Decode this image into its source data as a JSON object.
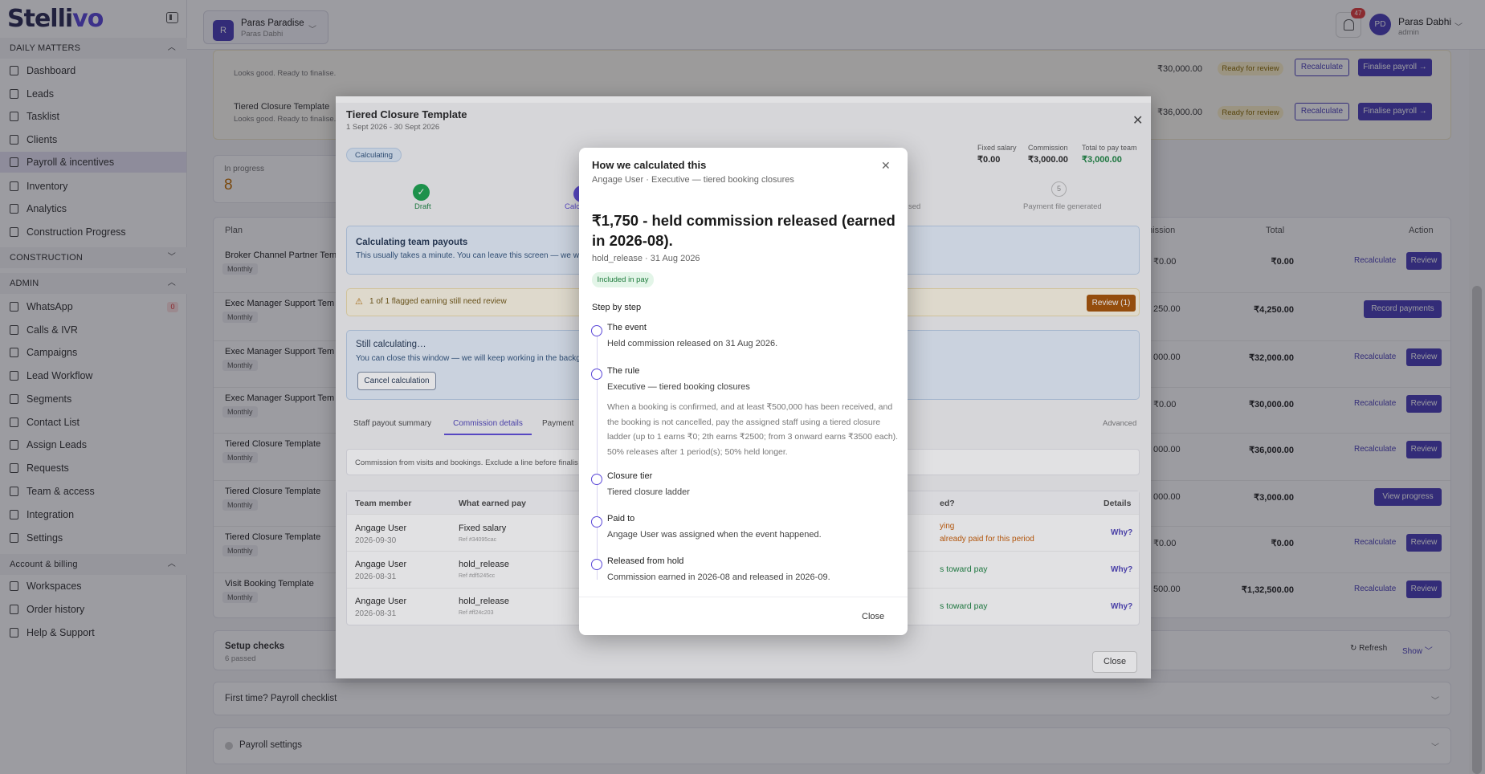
{
  "app": {
    "logo_a": "Stelli",
    "logo_b": "vo"
  },
  "sidebar": {
    "sections": {
      "daily": "DAILY MATTERS",
      "construction": "CONSTRUCTION",
      "admin": "ADMIN",
      "account": "Account & billing"
    },
    "items": [
      "Dashboard",
      "Leads",
      "Tasklist",
      "Clients",
      "Payroll & incentives",
      "Inventory",
      "Analytics",
      "Construction Progress",
      "WhatsApp",
      "Calls & IVR",
      "Campaigns",
      "Lead Workflow",
      "Segments",
      "Contact List",
      "Assign Leads",
      "Requests",
      "Team & access",
      "Integration",
      "Settings",
      "Workspaces",
      "Order history",
      "Help & Support"
    ],
    "whatsapp_count": "0"
  },
  "topbar": {
    "workspace_name": "Paras Paradise",
    "workspace_sub": "Paras Dabhi",
    "workspace_initial": "R",
    "notif_count": "47",
    "user_initials": "PD",
    "user_name": "Paras Dabhi",
    "user_role": "admin"
  },
  "bg": {
    "top_row1_note": "Looks good. Ready to finalise.",
    "top_row2_title": "Tiered Closure Template",
    "top_row2_note": "Looks good. Ready to finalise.",
    "top_row1_amount": "₹30,000.00",
    "top_row2_amount": "₹36,000.00",
    "ready": "Ready for review",
    "recalc": "Recalculate",
    "finalise": "Finalise payroll →",
    "in_progress_label": "In progress",
    "in_progress_value": "8",
    "col_plan": "Plan",
    "col_commission": "mission",
    "col_total": "Total",
    "col_action": "Action",
    "rows": [
      {
        "plan": "Broker Channel Partner Tem",
        "freq": "Monthly",
        "comm": "₹0.00",
        "total": "₹0.00",
        "action": "review"
      },
      {
        "plan": "Exec Manager Support Tem",
        "freq": "Monthly",
        "comm": "250.00",
        "total": "₹4,250.00",
        "action": "record"
      },
      {
        "plan": "Exec Manager Support Tem",
        "freq": "Monthly",
        "comm": "000.00",
        "total": "₹32,000.00",
        "action": "review"
      },
      {
        "plan": "Exec Manager Support Tem",
        "freq": "Monthly",
        "comm": "₹0.00",
        "total": "₹30,000.00",
        "action": "review"
      },
      {
        "plan": "Tiered Closure Template",
        "freq": "Monthly",
        "comm": "000.00",
        "total": "₹36,000.00",
        "action": "review"
      },
      {
        "plan": "Tiered Closure Template",
        "freq": "Monthly",
        "comm": "000.00",
        "total": "₹3,000.00",
        "action": "progress"
      },
      {
        "plan": "Tiered Closure Template",
        "freq": "Monthly",
        "comm": "₹0.00",
        "total": "₹0.00",
        "action": "review"
      },
      {
        "plan": "Visit Booking Template",
        "freq": "Monthly",
        "comm": "500.00",
        "total": "₹1,32,500.00",
        "action": "review"
      }
    ],
    "review": "Review",
    "record_payments": "Record payments",
    "view_progress": "View progress",
    "setup_title": "Setup checks",
    "setup_sub": "6 passed",
    "refresh": "Refresh",
    "show": "Show",
    "checklist": "First time? Payroll checklist",
    "settings": "Payroll settings"
  },
  "modal1": {
    "title": "Tiered Closure Template",
    "dates": "1 Sept 2026 - 30 Sept 2026",
    "status": "Calculating",
    "fixed_label": "Fixed salary",
    "fixed_value": "₹0.00",
    "comm_label": "Commission",
    "comm_value": "₹3,000.00",
    "total_label": "Total to pay team",
    "total_value": "₹3,000.00",
    "step1": "Draft",
    "step2": "Calc",
    "step4": "sed",
    "step5_num": "5",
    "step5": "Payment file generated",
    "calc_title": "Calculating team payouts",
    "calc_body": "This usually takes a minute. You can leave this screen — we will",
    "flag_text": "1 of 1 flagged earning still need review",
    "flag_btn": "Review (1)",
    "still_title": "Still calculating…",
    "still_body": "You can close this window — we will keep working in the backgro",
    "cancel": "Cancel calculation",
    "tabs": [
      "Staff payout summary",
      "Commission details",
      "Payment"
    ],
    "advanced": "Advanced",
    "hint": "Commission from visits and bookings. Exclude a line before finalis",
    "th": {
      "member": "Team member",
      "earned": "What earned pay",
      "counted": "ed?",
      "details": "Details"
    },
    "rows": [
      {
        "name": "Angage User",
        "date": "2026-09-30",
        "what": "Fixed salary",
        "ref": "Ref #34095cac",
        "status": "ying",
        "status2": "already paid for this period",
        "why": "Why?"
      },
      {
        "name": "Angage User",
        "date": "2026-08-31",
        "what": "hold_release",
        "ref": "Ref #df5245cc",
        "status": "s toward pay",
        "why": "Why?"
      },
      {
        "name": "Angage User",
        "date": "2026-08-31",
        "what": "hold_release",
        "ref": "Ref #ff24c203",
        "status": "s toward pay",
        "why": "Why?"
      }
    ],
    "close": "Close"
  },
  "modal2": {
    "title": "How we calculated this",
    "subtitle": "Angage User · Executive — tiered booking closures",
    "headline": "₹1,750 - held commission released (earned in 2026-08).",
    "meta": "hold_release · 31 Aug 2026",
    "badge": "Included in pay",
    "step_heading": "Step by step",
    "steps": [
      {
        "title": "The event",
        "body": "Held commission released on 31 Aug 2026."
      },
      {
        "title": "The rule",
        "body": "Executive — tiered booking closures",
        "detail": "When a booking is confirmed, and at least ₹500,000 has been received, and the booking is not cancelled, pay the assigned staff using a tiered closure ladder (up to 1 earns ₹0; 2th earns ₹2500; from 3 onward earns ₹3500 each). 50% releases after 1 period(s); 50% held longer."
      },
      {
        "title": "Closure tier",
        "body": "Tiered closure ladder"
      },
      {
        "title": "Paid to",
        "body": "Angage User was assigned when the event happened."
      },
      {
        "title": "Released from hold",
        "body": "Commission earned in 2026-08 and released in 2026-09."
      }
    ],
    "close": "Close"
  }
}
